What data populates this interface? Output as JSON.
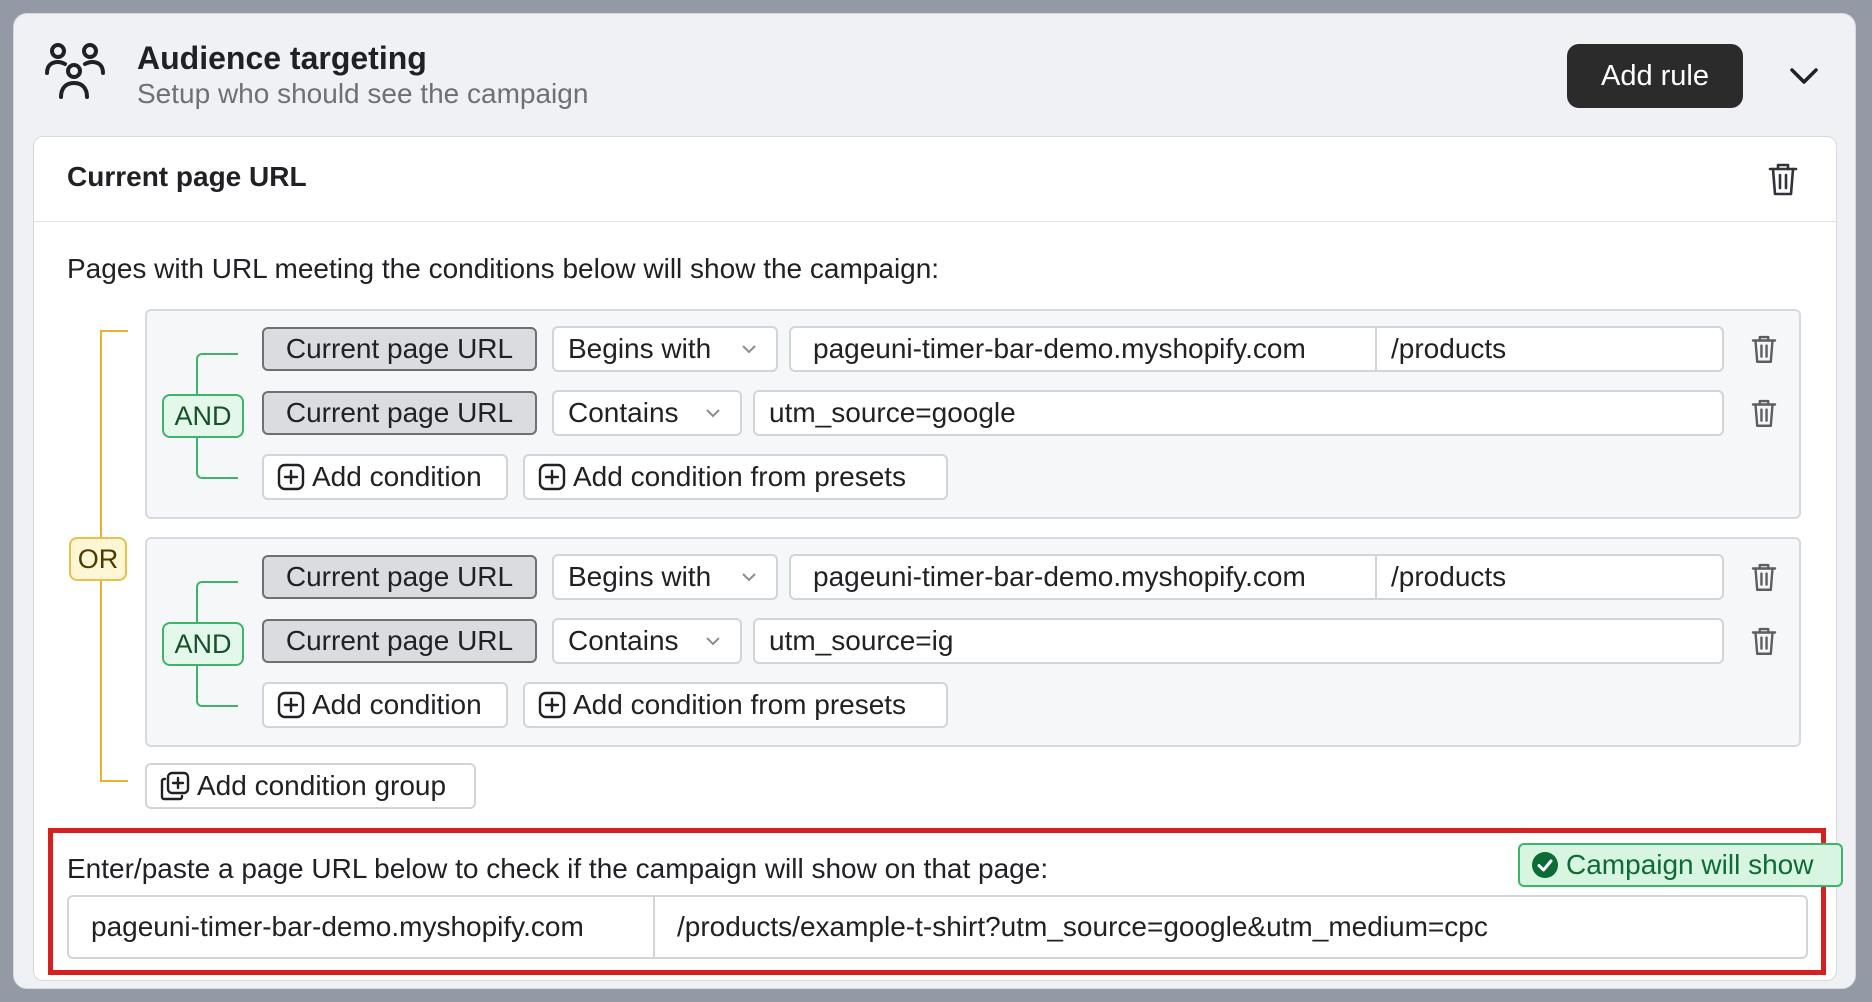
{
  "header": {
    "title": "Audience targeting",
    "subtitle": "Setup who should see the campaign",
    "add_rule_label": "Add rule",
    "icon": "people-group-icon"
  },
  "rule": {
    "title": "Current page URL",
    "intro": "Pages with URL meeting the conditions below will show the campaign:",
    "or_label": "OR",
    "groups": [
      {
        "and_label": "AND",
        "conditions": [
          {
            "field": "Current page URL",
            "operator": "Begins with",
            "domain": "pageuni-timer-bar-demo.myshopify.com",
            "value": "/products"
          },
          {
            "field": "Current page URL",
            "operator": "Contains",
            "value": "utm_source=google"
          }
        ],
        "add_condition": "Add condition",
        "add_condition_presets": "Add condition from presets"
      },
      {
        "and_label": "AND",
        "conditions": [
          {
            "field": "Current page URL",
            "operator": "Begins with",
            "domain": "pageuni-timer-bar-demo.myshopify.com",
            "value": "/products"
          },
          {
            "field": "Current page URL",
            "operator": "Contains",
            "value": "utm_source=ig"
          }
        ],
        "add_condition": "Add condition",
        "add_condition_presets": "Add condition from presets"
      }
    ],
    "add_group_label": "Add condition group"
  },
  "checker": {
    "label": "Enter/paste a page URL below to check if the campaign will show on that page:",
    "status": "Campaign will show",
    "domain": "pageuni-timer-bar-demo.myshopify.com",
    "path": "/products/example-t-shirt?utm_source=google&utm_medium=cpc"
  },
  "colors": {
    "accent_dark": "#2b2b2b",
    "or_color": "#e8b22e",
    "and_color": "#3fb36b",
    "highlight_border": "#d61f1f"
  }
}
